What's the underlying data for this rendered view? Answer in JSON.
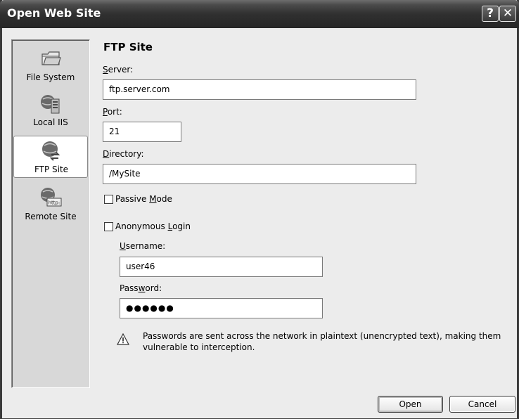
{
  "window": {
    "title": "Open Web Site"
  },
  "title_buttons": {
    "help": "?",
    "close": "✕"
  },
  "sidebar": {
    "items": [
      {
        "label": "File System",
        "icon": "folder-icon"
      },
      {
        "label": "Local IIS",
        "icon": "server-icon"
      },
      {
        "label": "FTP Site",
        "icon": "ftp-globe-icon",
        "selected": true
      },
      {
        "label": "Remote Site",
        "icon": "http-globe-icon"
      }
    ]
  },
  "main": {
    "heading": "FTP Site",
    "server": {
      "label_u": "S",
      "label_rest": "erver:",
      "value": "ftp.server.com"
    },
    "port": {
      "label_u": "P",
      "label_rest": "ort:",
      "value": "21"
    },
    "directory": {
      "label_u": "D",
      "label_rest": "irectory:",
      "value": "/MySite"
    },
    "passive": {
      "label_pre": "Passive ",
      "label_u": "M",
      "label_rest": "ode",
      "checked": false
    },
    "anonymous": {
      "label_pre": "Anonymous ",
      "label_u": "L",
      "label_rest": "ogin",
      "checked": false
    },
    "username": {
      "label_u": "U",
      "label_rest": "sername:",
      "value": "user46"
    },
    "password": {
      "label_pre": "Pass",
      "label_u": "w",
      "label_rest": "ord:",
      "value": "●●●●●●"
    },
    "warning": "Passwords are sent across the network in plaintext (unencrypted text), making them vulnerable to interception."
  },
  "buttons": {
    "open": "Open",
    "cancel": "Cancel"
  }
}
